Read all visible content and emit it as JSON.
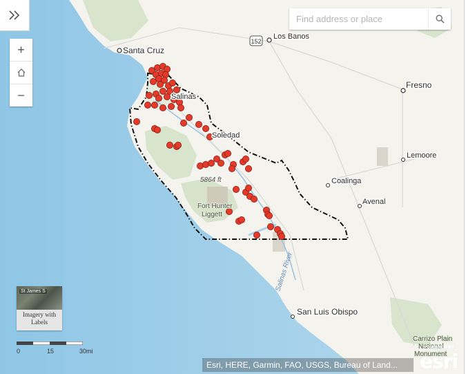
{
  "search": {
    "placeholder": "Find address or place"
  },
  "controls": {
    "expand_icon": "chevrons-right-icon",
    "zoom_in": "+",
    "home_icon": "home-icon",
    "zoom_out": "−",
    "search_icon": "search-icon"
  },
  "basemap": {
    "thumb_text": "St James S",
    "caption": "Imagery with Labels"
  },
  "scalebar": {
    "labels": [
      "0",
      "15",
      "30mi"
    ]
  },
  "attribution": "Esri, HERE, Garmin, FAO, USGS, Bureau of Land...",
  "logo": {
    "powered": "POWERED BY",
    "name": "esri"
  },
  "map": {
    "places": [
      "Santa Cruz",
      "Los Banos",
      "Fresno",
      "Salinas",
      "Soledad",
      "Lemoore",
      "Coalinga",
      "Avenal",
      "San Luis Obispo"
    ],
    "parks": [
      "Fort Hunter Liggett",
      "Carrizo Plain National Monument"
    ],
    "rivers": [
      "Salinas River"
    ],
    "shield": "152",
    "elevation": "5864 ft",
    "colors": {
      "ocean": "#a9d3ea",
      "land": "#f4f3ee",
      "park": "#d6e2c8",
      "marker": "#e23b2b",
      "boundary": "#111111"
    }
  }
}
